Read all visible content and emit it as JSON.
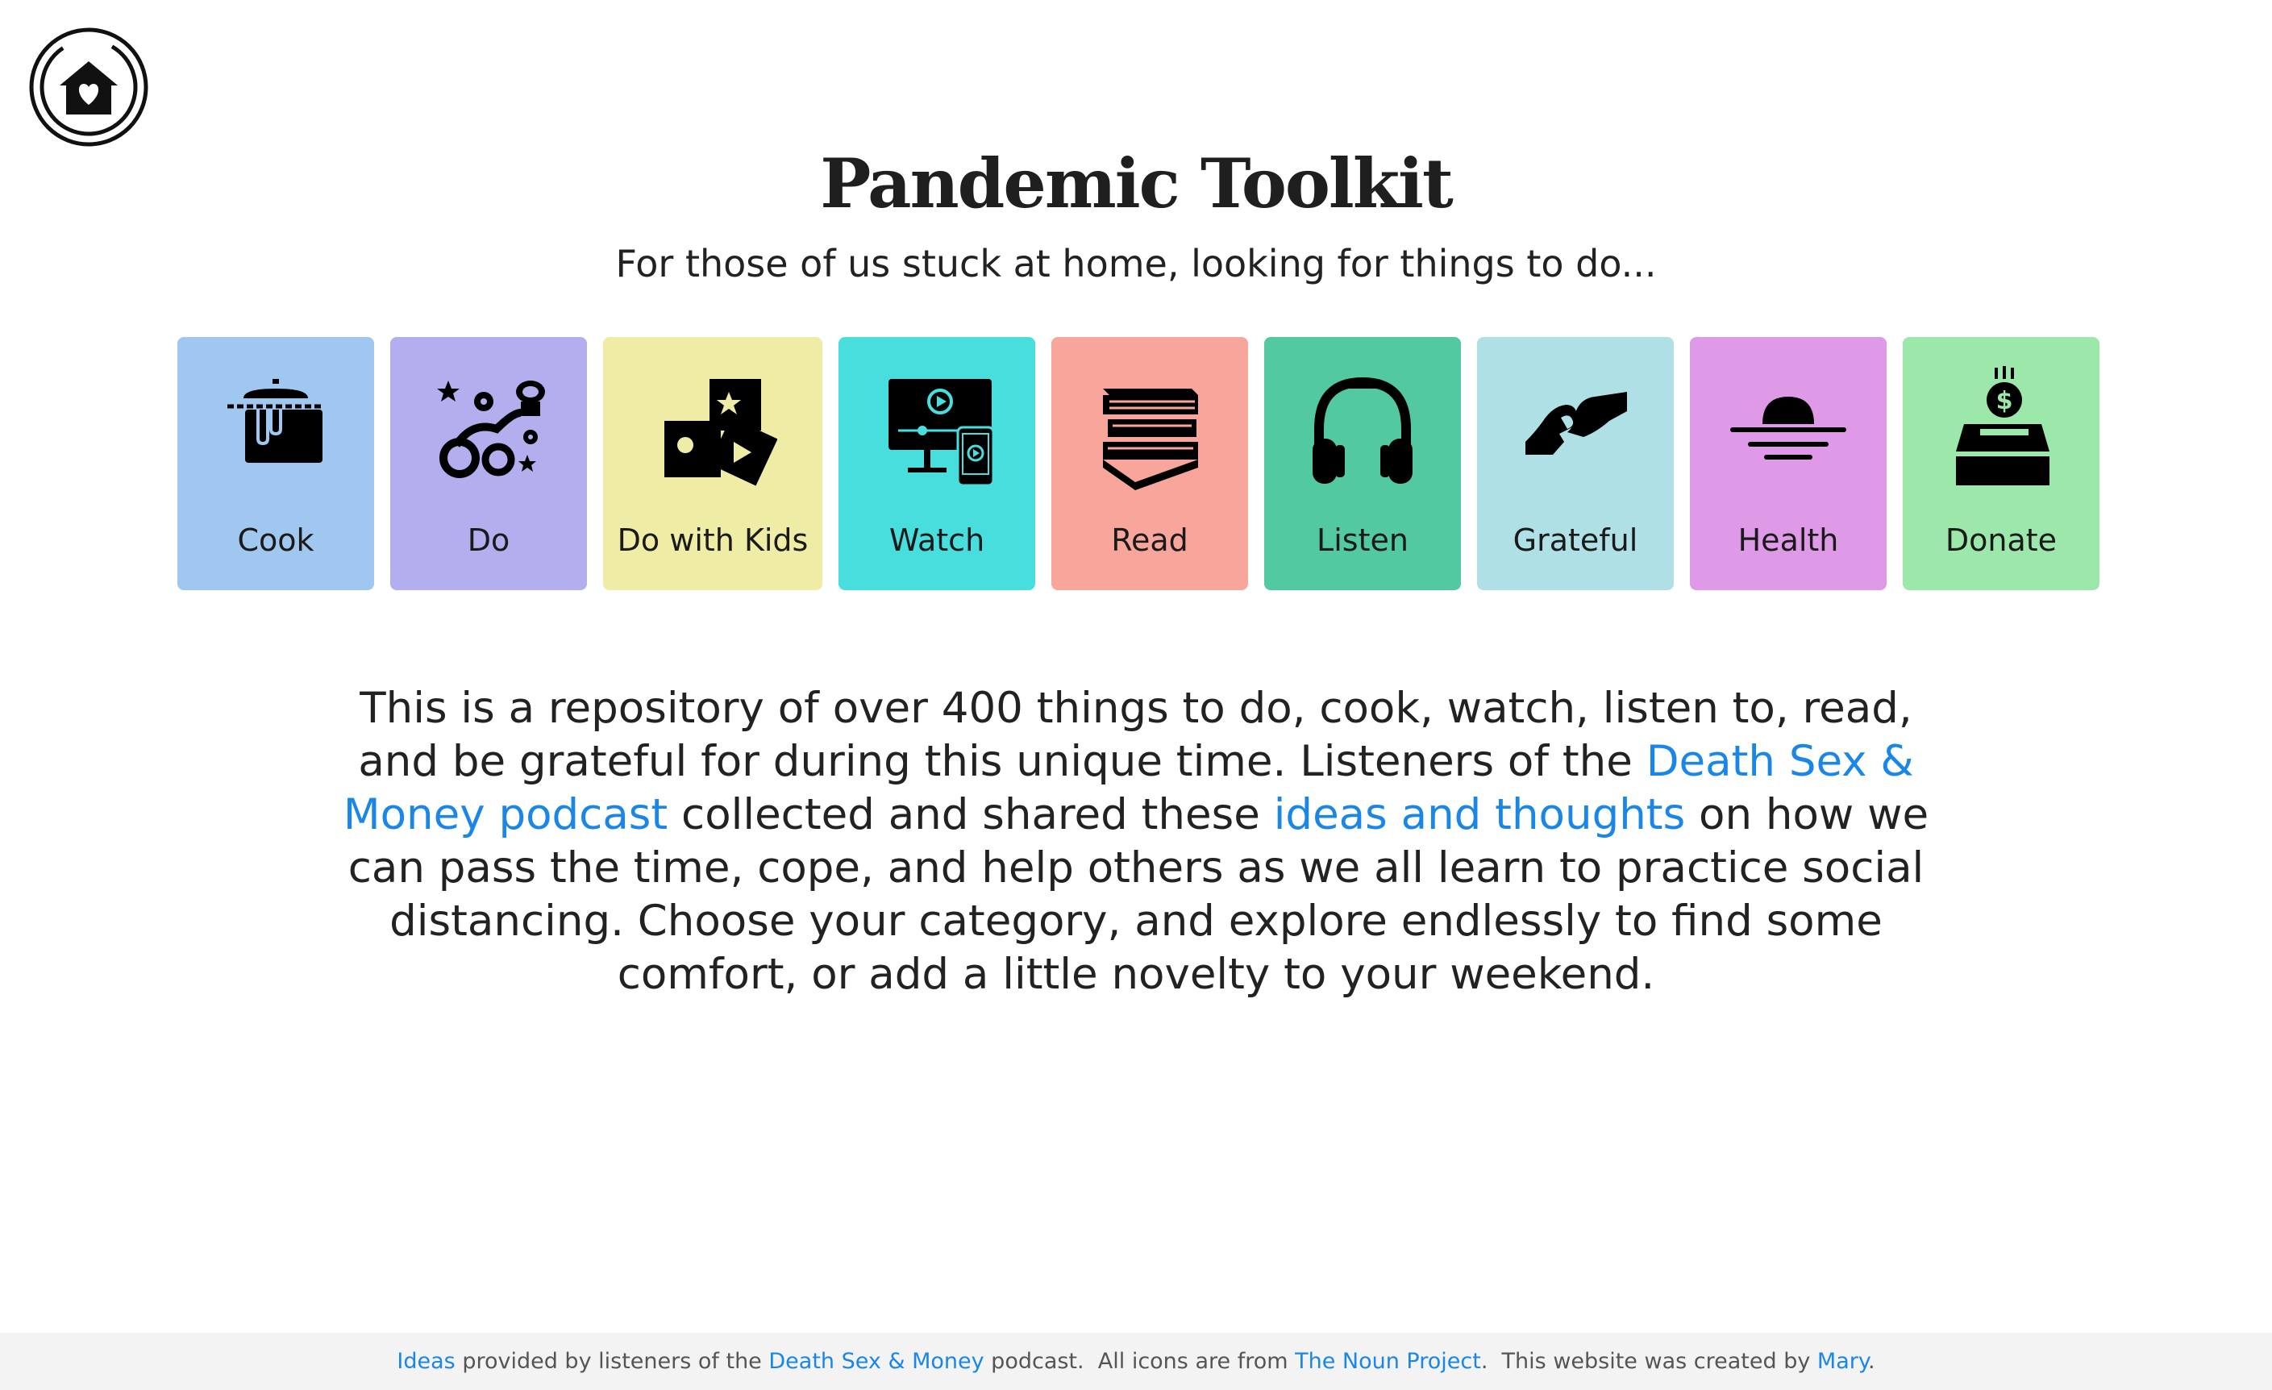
{
  "page": {
    "title": "Pandemic Toolkit",
    "subtitle": "For those of us stuck at home, looking for things to do..."
  },
  "categories": [
    {
      "label": "Cook",
      "color": "#9fc7ef",
      "icon": "cooking-pot-icon"
    },
    {
      "label": "Do",
      "color": "#b3aeee",
      "icon": "activities-icon"
    },
    {
      "label": "Do with Kids",
      "color": "#efeca6",
      "icon": "kids-blocks-icon"
    },
    {
      "label": "Watch",
      "color": "#49dede",
      "icon": "video-screens-icon"
    },
    {
      "label": "Read",
      "color": "#f8a59b",
      "icon": "book-stack-icon"
    },
    {
      "label": "Listen",
      "color": "#52c9a1",
      "icon": "headphones-icon"
    },
    {
      "label": "Grateful",
      "color": "#afe0e6",
      "icon": "heart-hands-icon"
    },
    {
      "label": "Health",
      "color": "#de9ae6",
      "icon": "sunset-horizon-icon"
    },
    {
      "label": "Donate",
      "color": "#9ce8ab",
      "icon": "donation-box-icon"
    }
  ],
  "description": {
    "part1": "This is a repository of over 400 things to do, cook, watch, listen to, read, and be grateful for during this unique time. Listeners of the ",
    "link1": "Death Sex & Money podcast",
    "part2": " collected and shared these ",
    "link2": "ideas and thoughts",
    "part3": " on how we can pass the time, cope, and help others as we all learn to practice social distancing. Choose your category, and explore endlessly to find some comfort, or add a little novelty to your weekend."
  },
  "footer": {
    "ideas_link": "Ideas",
    "t1": " provided by listeners of the ",
    "dsm_link": "Death Sex & Money",
    "t2": " podcast.  All icons are from ",
    "noun_link": "The Noun Project",
    "t3": ".  This website was created by ",
    "mary_link": "Mary",
    "t4": "."
  },
  "colors": {
    "link": "#1a86e8",
    "footer_bg": "#f3f3f3"
  }
}
